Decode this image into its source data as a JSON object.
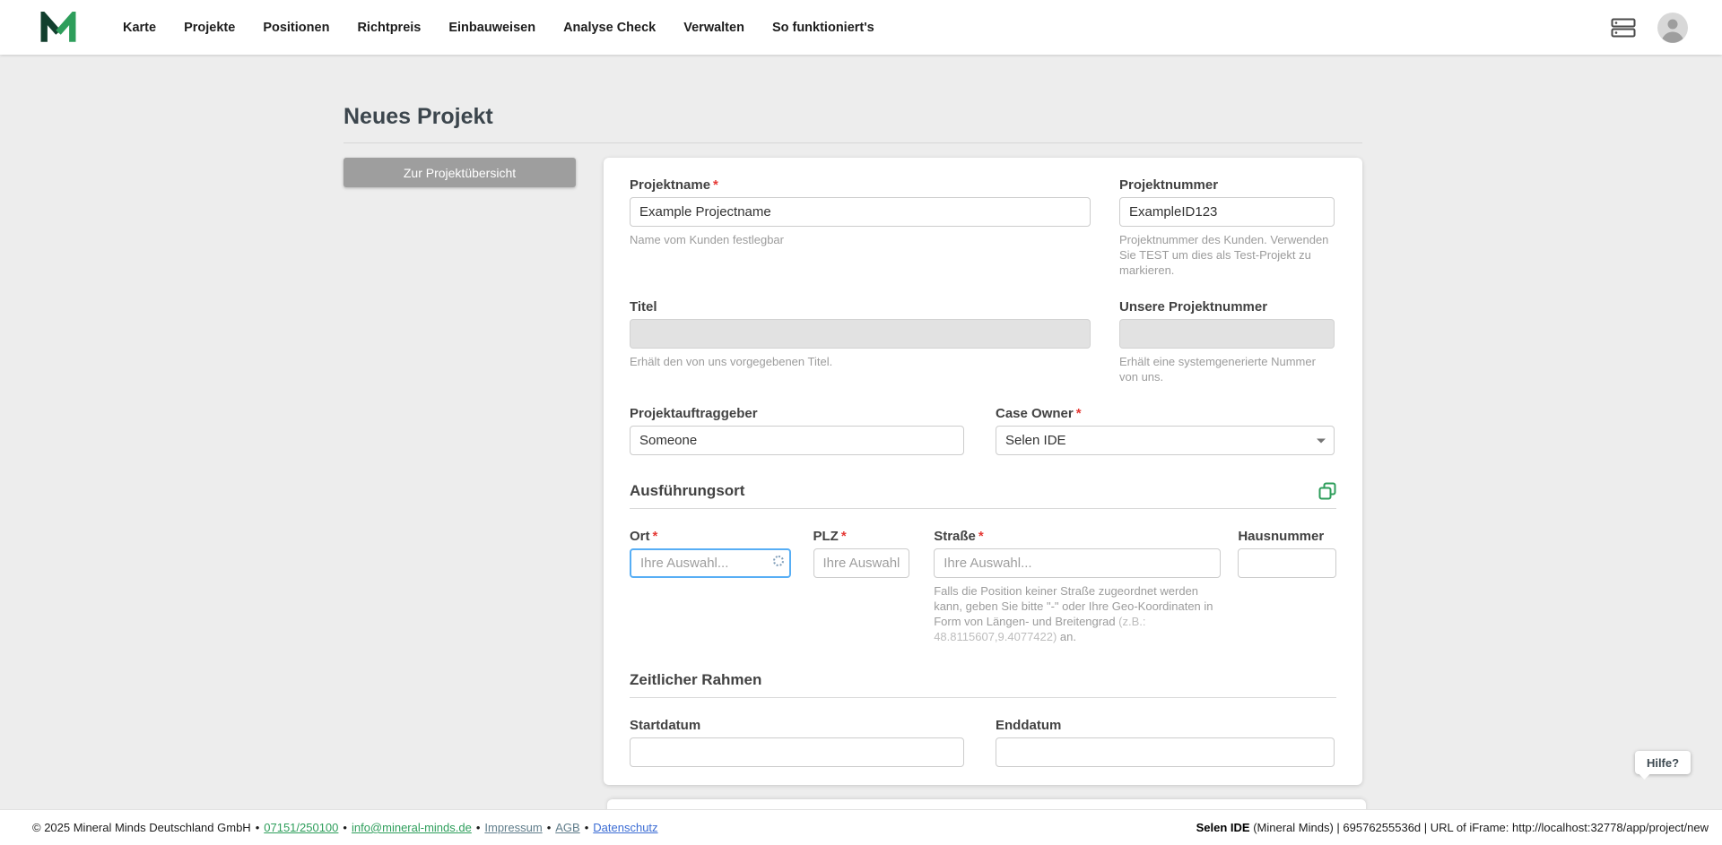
{
  "ui": {
    "required_marker": "*",
    "separator": "•"
  },
  "colors": {
    "accent_green": "#2e9e5b",
    "focus_blue": "#57aef5",
    "required_red": "#e53935",
    "button_gray": "#9e9e9e"
  },
  "nav": {
    "items": [
      {
        "label": "Karte"
      },
      {
        "label": "Projekte"
      },
      {
        "label": "Positionen"
      },
      {
        "label": "Richtpreis"
      },
      {
        "label": "Einbauweisen"
      },
      {
        "label": "Analyse Check"
      },
      {
        "label": "Verwalten"
      },
      {
        "label": "So funktioniert's"
      }
    ],
    "icons": [
      "mineral-minds-logo",
      "server-icon",
      "user-avatar-icon"
    ]
  },
  "page": {
    "title": "Neues Projekt",
    "back_button": "Zur Projektübersicht",
    "help_button": "Hilfe?"
  },
  "form": {
    "projektname": {
      "label": "Projektname",
      "value": "Example Projectname",
      "helper": "Name vom Kunden festlegbar"
    },
    "projektnummer": {
      "label": "Projektnummer",
      "value": "ExampleID123",
      "helper": "Projektnummer des Kunden. Verwenden Sie TEST um dies als Test-Projekt zu markieren."
    },
    "titel": {
      "label": "Titel",
      "value": "",
      "helper": "Erhält den von uns vorgegebenen Titel."
    },
    "unsere_projektnummer": {
      "label": "Unsere Projektnummer",
      "value": "",
      "helper": "Erhält eine systemgenerierte Nummer von uns."
    },
    "projektauftraggeber": {
      "label": "Projektauftraggeber",
      "value": "Someone"
    },
    "case_owner": {
      "label": "Case Owner",
      "value": "Selen IDE"
    },
    "section_ausfuehrungsort": "Ausführungsort",
    "section_zeitlicher_rahmen": "Zeitlicher Rahmen",
    "ort": {
      "label": "Ort",
      "placeholder": "Ihre Auswahl..."
    },
    "plz": {
      "label": "PLZ",
      "placeholder": "Ihre Auswahl."
    },
    "strasse": {
      "label": "Straße",
      "placeholder": "Ihre Auswahl...",
      "helper_main": "Falls die Position keiner Straße zugeordnet werden kann, geben Sie bitte \"-\" oder Ihre Geo-Koordinaten in Form von Längen- und Breitengrad ",
      "helper_example": "(z.B.: 48.8115607,9.4077422)",
      "helper_suffix": " an."
    },
    "hausnummer": {
      "label": "Hausnummer"
    },
    "startdatum": {
      "label": "Startdatum"
    },
    "enddatum": {
      "label": "Enddatum"
    }
  },
  "footer": {
    "copyright": "© 2025 Mineral Minds Deutschland GmbH",
    "phone": "07151/250100",
    "email": "info@mineral-minds.de",
    "impressum": "Impressum",
    "agb": "AGB",
    "datenschutz": "Datenschutz",
    "right_bold": "Selen IDE",
    "right_rest": " (Mineral Minds) | 69576255536d | URL of iFrame: http://localhost:32778/app/project/new"
  }
}
